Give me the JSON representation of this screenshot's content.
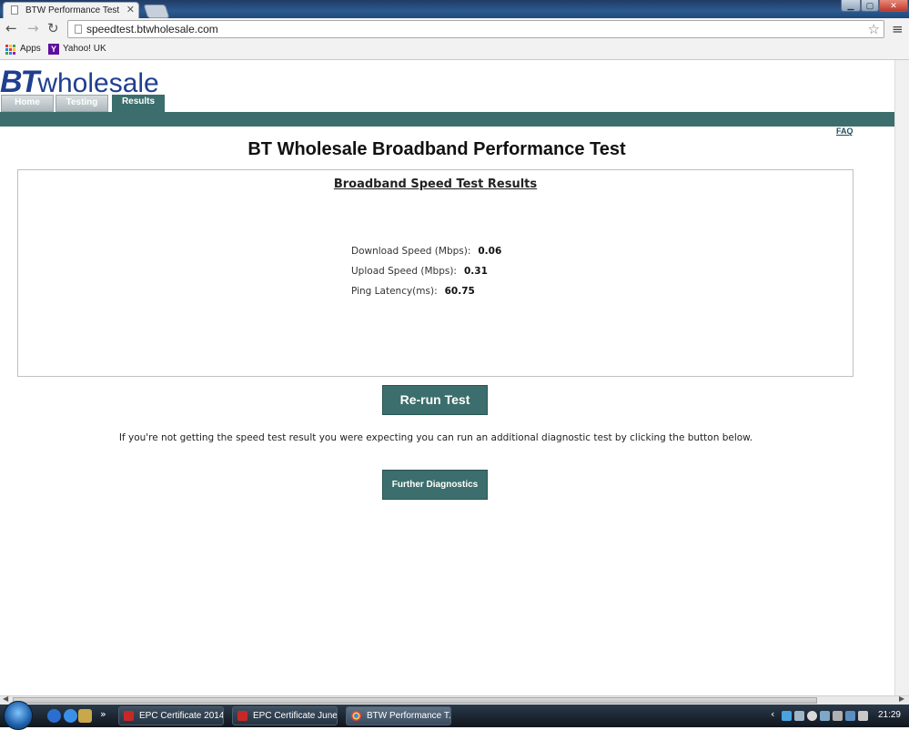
{
  "browser": {
    "tab_title": "BTW Performance Test",
    "tab_close": "✕",
    "url": "speedtest.btwholesale.com",
    "bookmarks": [
      {
        "label": "Apps"
      },
      {
        "label": "Yahoo! UK",
        "icon_letter": "Y"
      }
    ],
    "apps_icon_colors": [
      "#e53935",
      "#fbc02d",
      "#43a047",
      "#1e88e5",
      "#e53935",
      "#fbc02d",
      "#43a047",
      "#1e88e5",
      "#8e24aa"
    ]
  },
  "site": {
    "logo_bt": "BT",
    "logo_rest": "wholesale",
    "logo_color": "#1f3f8f",
    "nav_tabs": [
      {
        "label": "Home",
        "active": false
      },
      {
        "label": "Testing",
        "active": false
      },
      {
        "label": "Results",
        "active": true
      }
    ],
    "faq": "FAQ",
    "accent_color": "#3b6e6c"
  },
  "main": {
    "title": "BT Wholesale Broadband Performance Test",
    "results_heading": "Broadband Speed Test Results",
    "metrics": [
      {
        "label": "Download Speed (Mbps):",
        "value": "0.06"
      },
      {
        "label": "Upload Speed (Mbps):",
        "value": "0.31"
      },
      {
        "label": "Ping Latency(ms):",
        "value": "60.75"
      }
    ],
    "rerun_label": "Re-run Test",
    "diagnostic_text": "If you're not getting the speed test result you were expecting you can run an additional diagnostic test by clicking the button below.",
    "diagnostics_label": "Further Diagnostics"
  },
  "taskbar": {
    "tasks": [
      {
        "label": "EPC Certificate 2014...",
        "icon": "pdf"
      },
      {
        "label": "EPC Certificate June...",
        "icon": "pdf"
      },
      {
        "label": "BTW Performance T...",
        "icon": "chrome",
        "active": true
      }
    ],
    "clock": "21:29"
  }
}
